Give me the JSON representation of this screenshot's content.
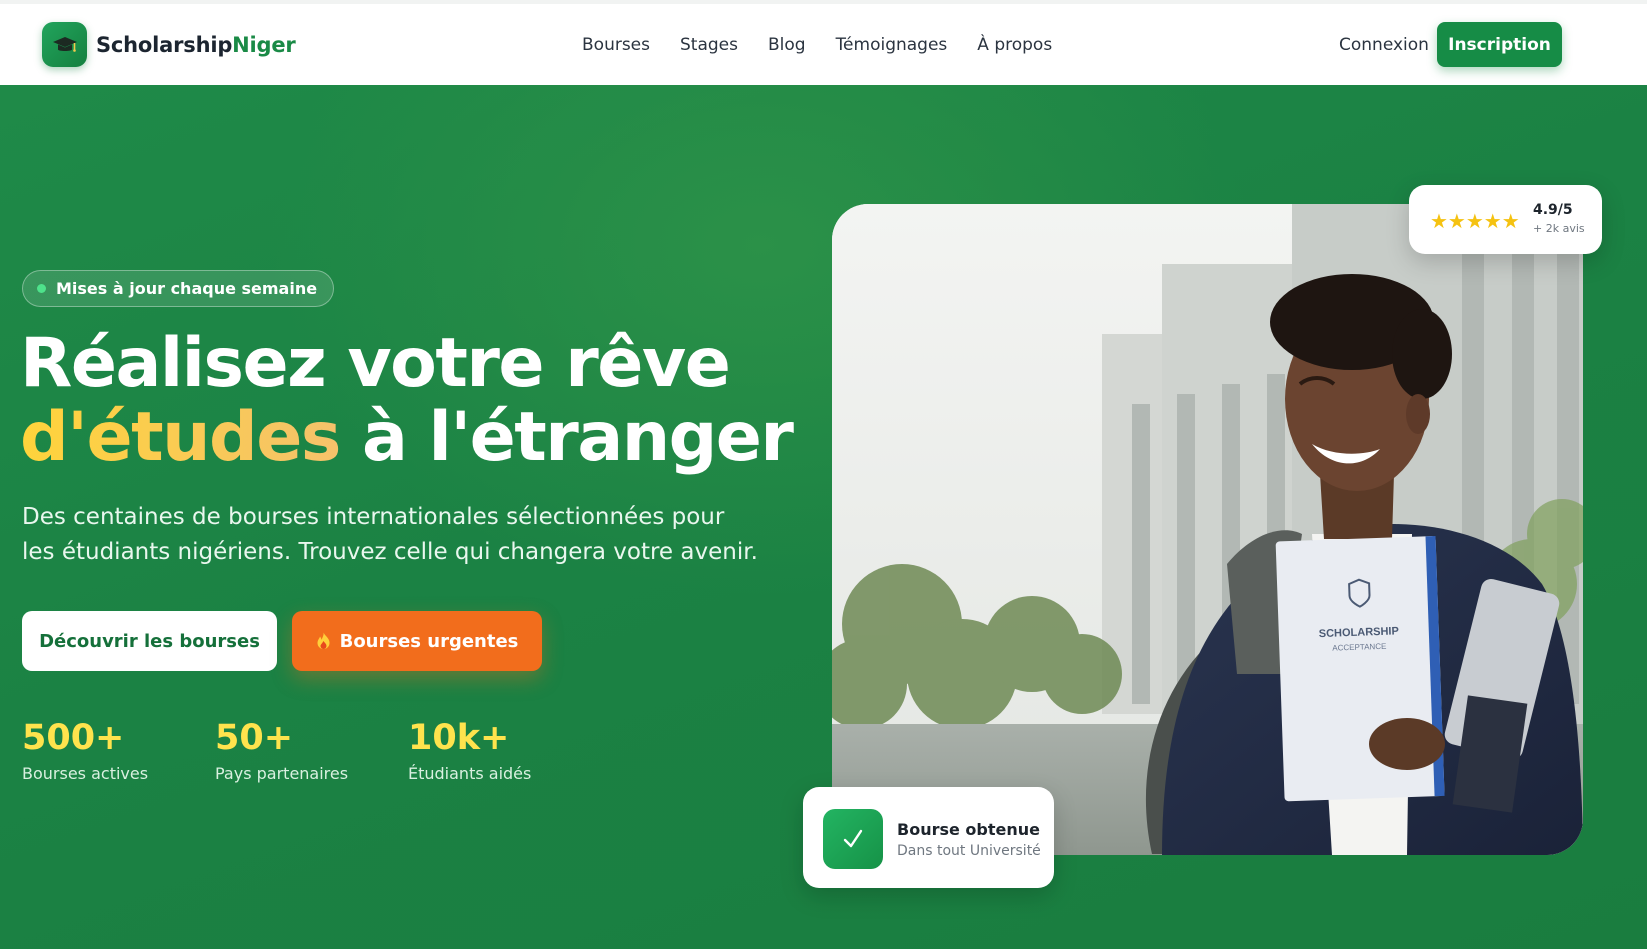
{
  "brand": {
    "name_part1": "Scholarship",
    "name_part2": "Niger",
    "logo_icon": "graduation-cap-icon"
  },
  "nav": {
    "items": [
      {
        "label": "Bourses"
      },
      {
        "label": "Stages"
      },
      {
        "label": "Blog"
      },
      {
        "label": "Témoignages"
      },
      {
        "label": "À propos"
      }
    ],
    "login_label": "Connexion",
    "signup_label": "Inscription"
  },
  "hero": {
    "badge": "Mises à jour chaque semaine",
    "title_line1": "Réalisez votre rêve",
    "title_highlight": "d'études",
    "title_rest": " à l'étranger",
    "subtitle": "Des centaines de bourses internationales sélectionnées pour les étudiants nigériens. Trouvez celle qui changera votre avenir.",
    "cta_primary": "Découvrir les bourses",
    "cta_secondary": "Bourses urgentes",
    "cta_secondary_icon": "fire-icon"
  },
  "stats": [
    {
      "value": "500+",
      "label": "Bourses actives"
    },
    {
      "value": "50+",
      "label": "Pays partenaires"
    },
    {
      "value": "10k+",
      "label": "Étudiants aidés"
    }
  ],
  "image": {
    "folder_title": "SCHOLARSHIP",
    "folder_subtitle": "ACCEPTANCE"
  },
  "rating_card": {
    "stars": "★★★★★",
    "rating": 4.9,
    "value": "4.9/5",
    "reviews": "+ 2k avis"
  },
  "award_card": {
    "title": "Bourse obtenue",
    "subtitle": "Dans tout Université",
    "icon": "check-icon"
  },
  "colors": {
    "brand_green": "#168c46",
    "hero_green": "#1d8746",
    "highlight_gold": "#ffd43b",
    "urgent_orange": "#f26d1c",
    "stat_yellow": "#ffe34d",
    "star_gold": "#f5c211"
  }
}
